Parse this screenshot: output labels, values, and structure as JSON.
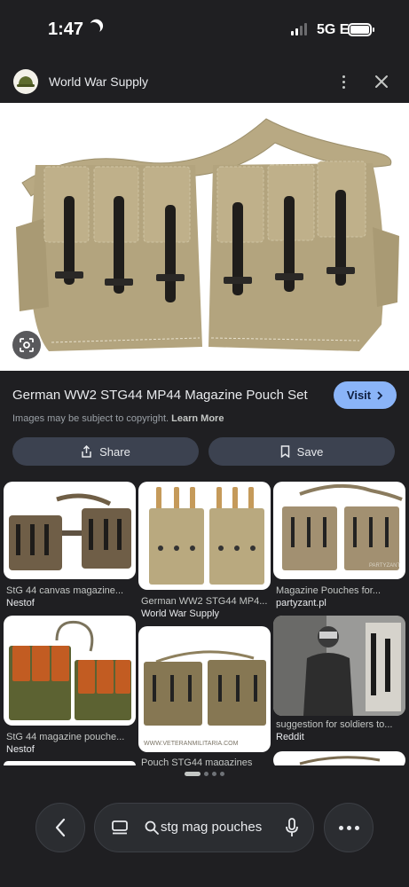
{
  "status_bar": {
    "time": "1:47",
    "network": "5G E"
  },
  "header": {
    "source_name": "World War Supply"
  },
  "result": {
    "title": "German WW2 STG44 MP44 Magazine Pouch Set",
    "visit_label": "Visit",
    "copyright_text": "Images may be subject to copyright.",
    "learn_more": "Learn More",
    "share_label": "Share",
    "save_label": "Save"
  },
  "related": [
    {
      "caption": "StG 44 canvas magazine...",
      "source": "Nestof"
    },
    {
      "caption": "German WW2 STG44 MP4...",
      "source": "World War Supply"
    },
    {
      "caption": "Magazine Pouches for...",
      "source": "partyzant.pl"
    },
    {
      "caption": "StG 44 magazine pouche...",
      "source": "Nestof"
    },
    {
      "caption": "Pouch STG44 magazines",
      "source": ""
    },
    {
      "caption": "suggestion for soldiers to...",
      "source": "Reddit"
    }
  ],
  "watermarks": {
    "veteran": "WWW.VETERANMILITARIA.COM",
    "partyzant": "PARTYZANT"
  },
  "bottom_bar": {
    "search_query": "stg mag pouches"
  },
  "colors": {
    "background": "#1f1f22",
    "visit": "#8ab4f8",
    "button": "#3c4250",
    "canvas": "#b5a681"
  }
}
